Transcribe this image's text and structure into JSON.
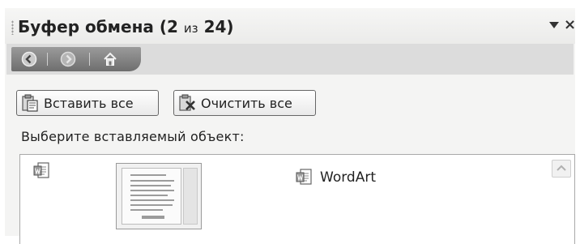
{
  "panel": {
    "title": "Буфер обмена (2",
    "title_small": "из",
    "title_count": "24)",
    "menu_icon": "dropdown-arrow-icon",
    "close_icon": "close-icon",
    "close_glyph": "×"
  },
  "nav": {
    "items": [
      {
        "name": "back",
        "icon": "arrow-left-icon"
      },
      {
        "name": "forward",
        "icon": "arrow-right-icon"
      },
      {
        "name": "home",
        "icon": "home-icon"
      }
    ]
  },
  "actions": {
    "paste_all_label": "Вставить все",
    "clear_all_label": "Очистить все"
  },
  "prompt_text": "Выберите вставляемый объект:",
  "clipboard_items": [
    {
      "type": "document",
      "icon": "word-document-icon",
      "preview": "page-thumbnail"
    },
    {
      "type": "wordart",
      "icon": "word-document-icon",
      "label": "WordArt"
    }
  ]
}
